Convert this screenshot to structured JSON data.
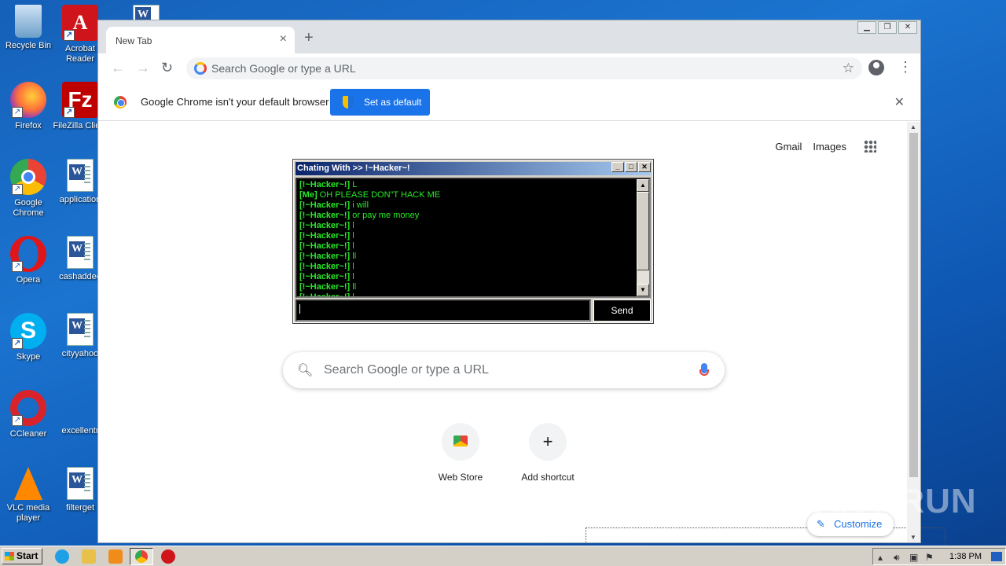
{
  "desktop": {
    "icons": [
      {
        "label": "Recycle Bin"
      },
      {
        "label": "Acrobat Reader"
      },
      {
        "label": "Firefox"
      },
      {
        "label": "FileZilla Client"
      },
      {
        "label": "Google Chrome"
      },
      {
        "label": "application"
      },
      {
        "label": "Opera"
      },
      {
        "label": "cashadded"
      },
      {
        "label": "Skype"
      },
      {
        "label": "cityyahoo"
      },
      {
        "label": "CCleaner"
      },
      {
        "label": "excellentr"
      },
      {
        "label": "VLC media player"
      },
      {
        "label": "filterget"
      }
    ]
  },
  "browser": {
    "tab_title": "New Tab",
    "tab_close": "×",
    "new_tab": "+",
    "omnibox_placeholder": "Search Google or type a URL",
    "infobar": {
      "message": "Google Chrome isn't your default browser",
      "button": "Set as default",
      "close": "✕"
    },
    "top_links": [
      "Gmail",
      "Images"
    ],
    "search_placeholder": "Search Google or type a URL",
    "shortcuts": [
      {
        "label": "Web Store",
        "icon": "web-store-icon"
      },
      {
        "label": "Add shortcut",
        "icon": "plus-icon"
      }
    ],
    "customize_label": "Customize"
  },
  "chat": {
    "title": "Chating With >> !~Hacker~!",
    "messages": [
      {
        "sender": "[!~Hacker~!]",
        "text": "L"
      },
      {
        "sender": "[Me]",
        "text": "OH PLEASE DON\"T HACK ME"
      },
      {
        "sender": "[!~Hacker~!]",
        "text": "i will"
      },
      {
        "sender": "[!~Hacker~!]",
        "text": "or pay me money"
      },
      {
        "sender": "[!~Hacker~!]",
        "text": "l"
      },
      {
        "sender": "[!~Hacker~!]",
        "text": "l"
      },
      {
        "sender": "[!~Hacker~!]",
        "text": "l"
      },
      {
        "sender": "[!~Hacker~!]",
        "text": "ll"
      },
      {
        "sender": "[!~Hacker~!]",
        "text": "l"
      },
      {
        "sender": "[!~Hacker~!]",
        "text": "l"
      },
      {
        "sender": "[!~Hacker~!]",
        "text": "ll"
      },
      {
        "sender": "[!~Hacker~!]",
        "text": "l"
      }
    ],
    "input_value": "",
    "send_label": "Send"
  },
  "taskbar": {
    "start_label": "Start",
    "clock": "1:38 PM"
  },
  "watermark": "ANY RUN",
  "colors": {
    "chat_text": "#29e829",
    "accent": "#1a73e8",
    "desktop": "#1560b8"
  }
}
